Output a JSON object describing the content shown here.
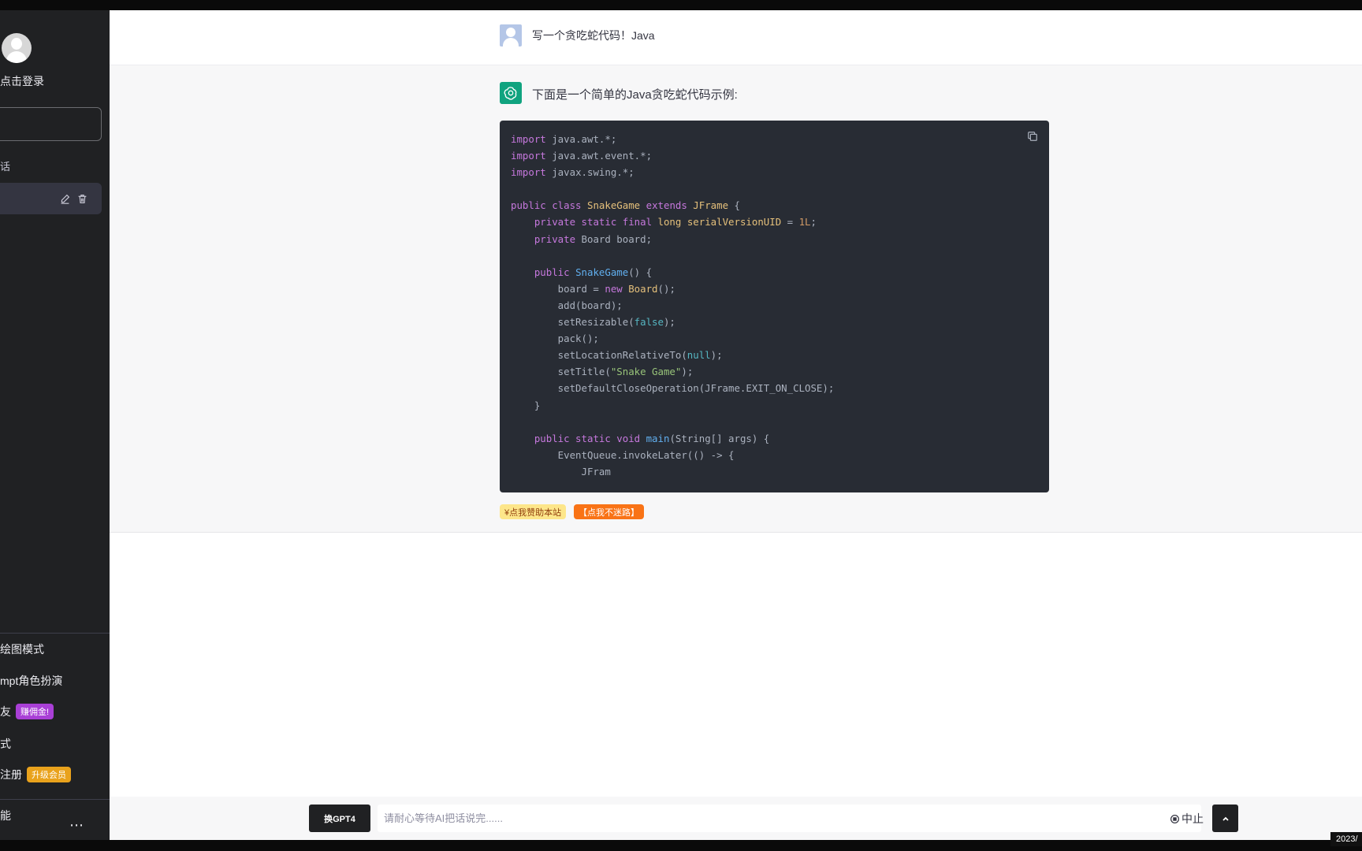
{
  "sidebar": {
    "login_text": "点击登录",
    "section_label": "话",
    "menu": [
      {
        "label": "绘图模式"
      },
      {
        "label": "mpt角色扮演"
      },
      {
        "label": "友",
        "badge": "赚佣金!"
      },
      {
        "label": "式"
      },
      {
        "label": "注册",
        "badge": "升级会员"
      }
    ],
    "bottom_label": "能",
    "more_icon": "⋯"
  },
  "chat": {
    "user_message": "写一个贪吃蛇代码！Java",
    "assistant_intro": "下面是一个简单的Java贪吃蛇代码示例:",
    "pill_sponsor": "¥点我赞助本站",
    "pill_guide": "【点我不迷路】"
  },
  "input": {
    "model_button": "换GPT4",
    "placeholder": "请耐心等待AI把话说完......",
    "stop_label": "中止"
  },
  "timestamp": "2023/",
  "colors": {
    "sidebar_bg": "#202123",
    "code_bg": "#282c34",
    "gpt_green": "#10a37f"
  }
}
